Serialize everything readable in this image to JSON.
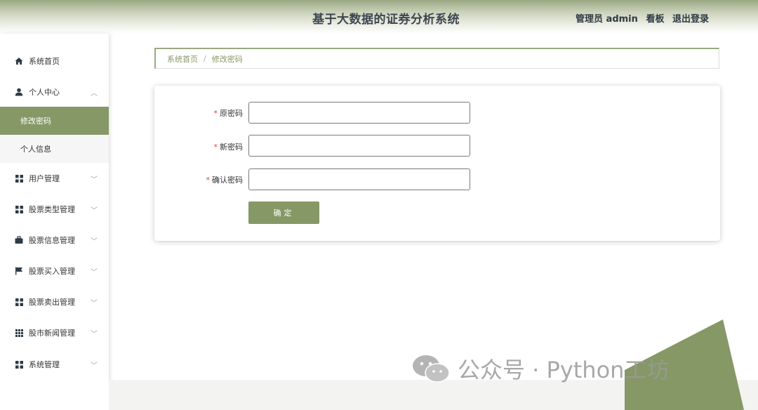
{
  "header": {
    "title": "基于大数据的证券分析系统",
    "user_label": "管理员 admin",
    "dashboard_link": "看板",
    "logout_link": "退出登录"
  },
  "sidebar": {
    "items": [
      {
        "label": "系统首页",
        "icon": "home-icon"
      },
      {
        "label": "个人中心",
        "icon": "user-icon",
        "expanded": true
      },
      {
        "label": "用户管理",
        "icon": "grid-icon"
      },
      {
        "label": "股票类型管理",
        "icon": "grid-icon"
      },
      {
        "label": "股票信息管理",
        "icon": "briefcase-icon"
      },
      {
        "label": "股票买入管理",
        "icon": "flag-icon"
      },
      {
        "label": "股票卖出管理",
        "icon": "grid-icon"
      },
      {
        "label": "股市新闻管理",
        "icon": "grid9-icon"
      },
      {
        "label": "系统管理",
        "icon": "grid-icon"
      }
    ],
    "subitems": [
      {
        "label": "修改密码",
        "active": true
      },
      {
        "label": "个人信息",
        "active": false
      }
    ]
  },
  "breadcrumb": {
    "home": "系统首页",
    "separator": "/",
    "current": "修改密码"
  },
  "form": {
    "fields": [
      {
        "label": "原密码",
        "value": "",
        "required": true
      },
      {
        "label": "新密码",
        "value": "",
        "required": true
      },
      {
        "label": "确认密码",
        "value": "",
        "required": true
      }
    ],
    "submit_label": "确定"
  },
  "watermark": {
    "text": "公众号 · Python工坊"
  },
  "colors": {
    "accent": "#869865",
    "header_gradient_top": "#9aa882",
    "required_star": "#e0413f"
  }
}
